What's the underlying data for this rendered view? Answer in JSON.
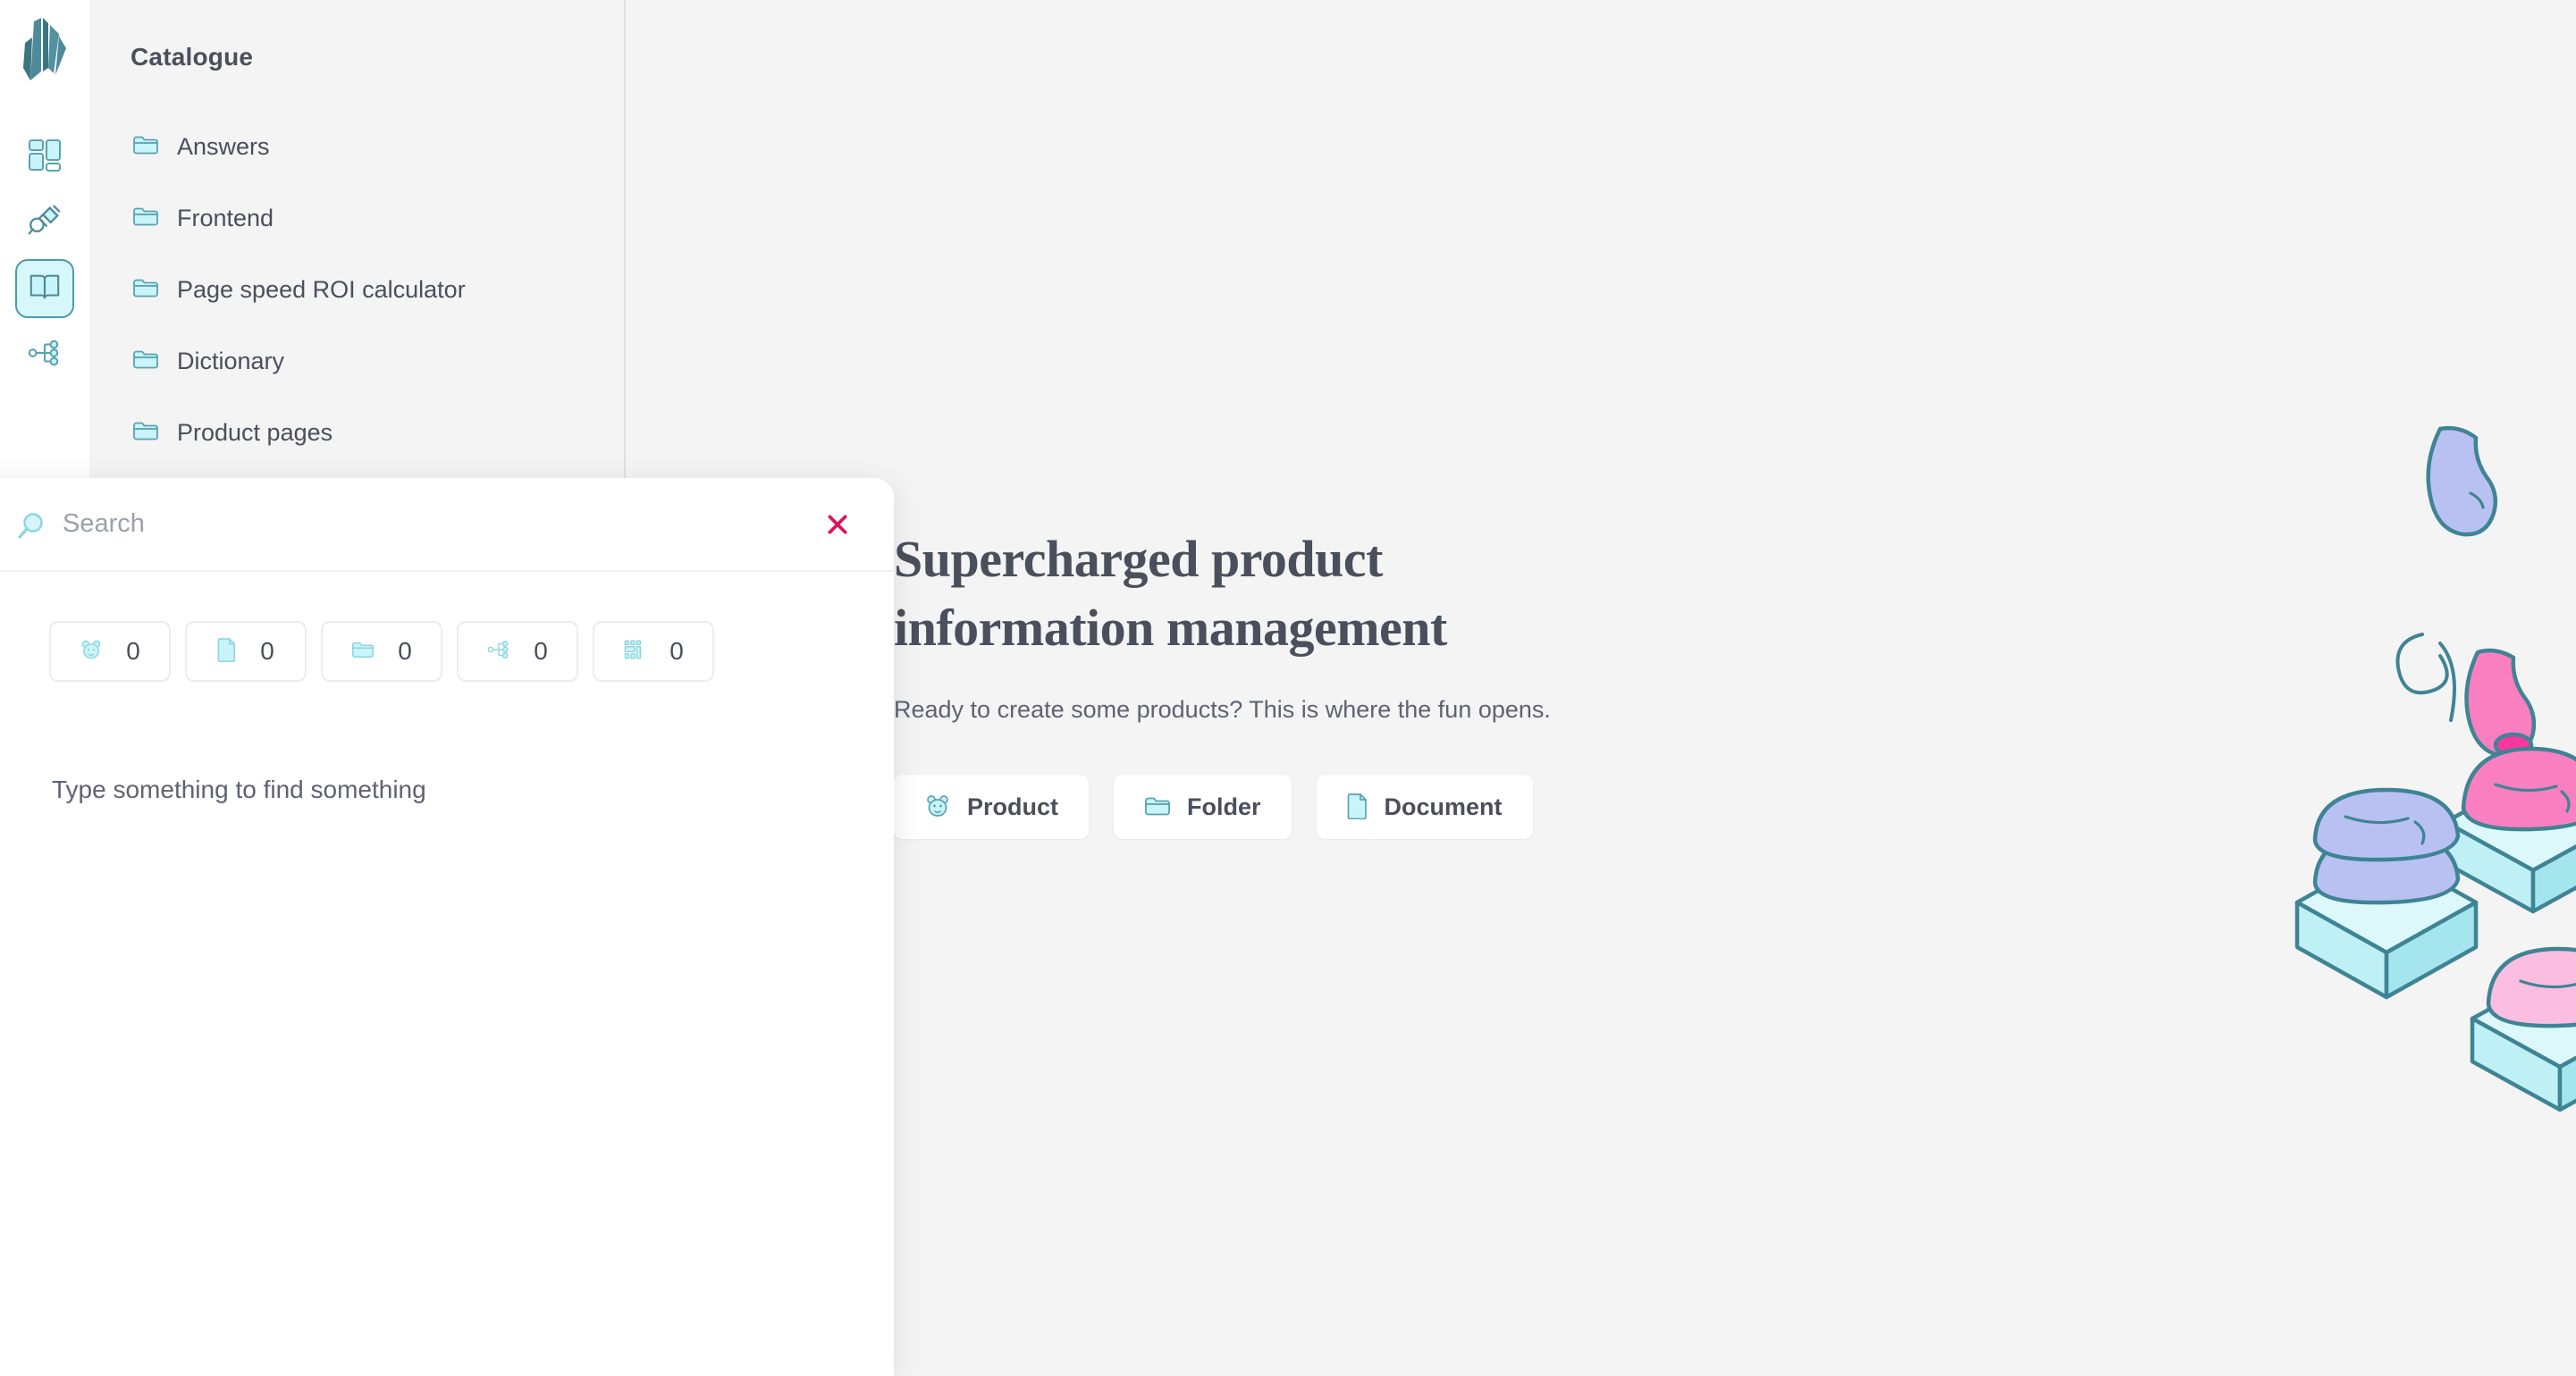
{
  "rail": {
    "logo_icon": "crystal-logo-icon",
    "items": [
      {
        "icon": "dashboard-grid-icon",
        "name": "dashboard",
        "active": false
      },
      {
        "icon": "plug-connector-icon",
        "name": "connectors",
        "active": false
      },
      {
        "icon": "book-catalogue-icon",
        "name": "catalogue",
        "active": true
      },
      {
        "icon": "hierarchy-tree-icon",
        "name": "hierarchy",
        "active": false
      }
    ]
  },
  "panel": {
    "title": "Catalogue",
    "items": [
      {
        "icon": "folder-icon",
        "label": "Answers"
      },
      {
        "icon": "folder-icon",
        "label": "Frontend"
      },
      {
        "icon": "folder-icon",
        "label": "Page speed ROI calculator"
      },
      {
        "icon": "folder-icon",
        "label": "Dictionary"
      },
      {
        "icon": "folder-icon",
        "label": "Product pages"
      }
    ]
  },
  "hero": {
    "title_line1": "Supercharged product",
    "title_line2": "information management",
    "subtitle": "Ready to create some products? This is where the fun opens.",
    "actions": [
      {
        "icon": "product-bear-icon",
        "label": "Product"
      },
      {
        "icon": "folder-icon",
        "label": "Folder"
      },
      {
        "icon": "document-icon",
        "label": "Document"
      }
    ]
  },
  "search_modal": {
    "search_icon": "magnifier-icon",
    "placeholder": "Search",
    "value": "",
    "close_icon": "close-x-icon",
    "close_color": "#e0115f",
    "chips": [
      {
        "icon": "product-bear-icon",
        "count": "0"
      },
      {
        "icon": "document-icon",
        "count": "0"
      },
      {
        "icon": "folder-icon",
        "count": "0"
      },
      {
        "icon": "hierarchy-tree-icon",
        "count": "0"
      },
      {
        "icon": "grid-layout-icon",
        "count": "0"
      }
    ],
    "empty_message": "Type something to find something"
  },
  "colors": {
    "background": "#f4f4f4",
    "panel_bg": "#f4f4f4",
    "rail_bg": "#ffffff",
    "accent_teal": "#4e9aa8",
    "icon_fill": "#c9f4f9",
    "text_dark": "#4a4f5c",
    "text_muted": "#5d6373",
    "close_pink": "#e0115f",
    "active_chip_bg": "#d6f7fb"
  },
  "illustration": {
    "name": "isometric-product-boxes-illustration",
    "palette": {
      "box": "#c9f4f9",
      "box_side": "#aee9f0",
      "outline": "#3f8494",
      "pink": "#f97fc0",
      "hot_pink": "#f9379f",
      "light_pink": "#fbbde2",
      "periwinkle": "#b9c1f3",
      "green": "#a8ef85",
      "yellow": "#fbf2a0",
      "orange": "#f9c579",
      "blue": "#a8d5f5",
      "grey_green": "#8fb6b6"
    }
  }
}
